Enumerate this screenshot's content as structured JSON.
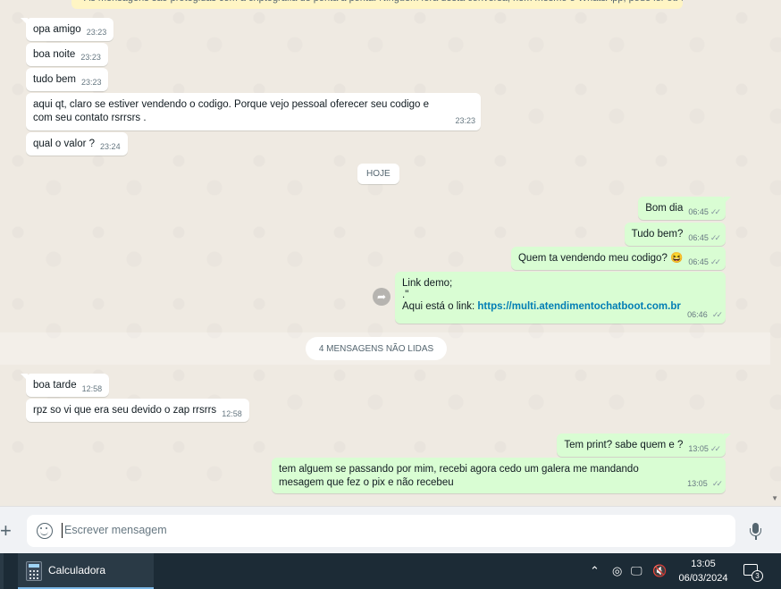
{
  "banner": {
    "text": "As mensagens são protegidas com a criptografia de ponta a ponta. Ninguém fora desta conversa, nem mesmo o WhatsApp, pode ler ou ouvi-las. Clique para saber mais."
  },
  "messages_top": [
    {
      "text": "opa amigo",
      "time": "23:23"
    },
    {
      "text": "boa noite",
      "time": "23:23"
    },
    {
      "text": "tudo bem",
      "time": "23:23"
    },
    {
      "text": "aqui qt, claro se estiver vendendo o codigo. Porque vejo pessoal oferecer seu codigo e com seu contato rsrrsrs .",
      "time": "23:23"
    },
    {
      "text": "qual o valor ?",
      "time": "23:24"
    }
  ],
  "date_divider": "HOJE",
  "messages_out_1": [
    {
      "text": "Bom dia",
      "time": "06:45"
    },
    {
      "text": "Tudo bem?",
      "time": "06:45"
    },
    {
      "text": "Quem ta vendendo meu codigo? 😆",
      "time": "06:45"
    }
  ],
  "link_message": {
    "line1": "Link demo;",
    "line2": ".\"",
    "prefix": " Aqui está o link: ",
    "url": "https://multi.atendimentochatboot.com.br",
    "time": "06:46"
  },
  "unread_label": "4 MENSAGENS NÃO LIDAS",
  "messages_in_2": [
    {
      "text": "boa tarde",
      "time": "12:58"
    },
    {
      "text": "rpz so vi que era seu devido o zap rrsrrs",
      "time": "12:58"
    }
  ],
  "messages_out_2": [
    {
      "text": "Tem print? sabe quem e ?",
      "time": "13:05"
    },
    {
      "text": "tem alguem se passando por mim, recebi agora cedo um galera me mandando mesagem que fez o pix e não recebeu",
      "time": "13:05"
    }
  ],
  "composer": {
    "placeholder": "Escrever mensagem"
  },
  "taskbar": {
    "app_label": "Calculadora",
    "time": "13:05",
    "date": "06/03/2024",
    "notification_count": "3"
  },
  "icons": {
    "read_ticks": "✓✓",
    "forward": "➦",
    "plus": "+",
    "chevron": "⌃",
    "camera": "◎",
    "network": "🖵",
    "mute": "🔇"
  },
  "colors": {
    "outgoing_bubble": "#d9fdd3",
    "incoming_bubble": "#ffffff",
    "chat_bg": "#efeae2",
    "link": "#027eb5",
    "taskbar": "#1c2b36"
  }
}
